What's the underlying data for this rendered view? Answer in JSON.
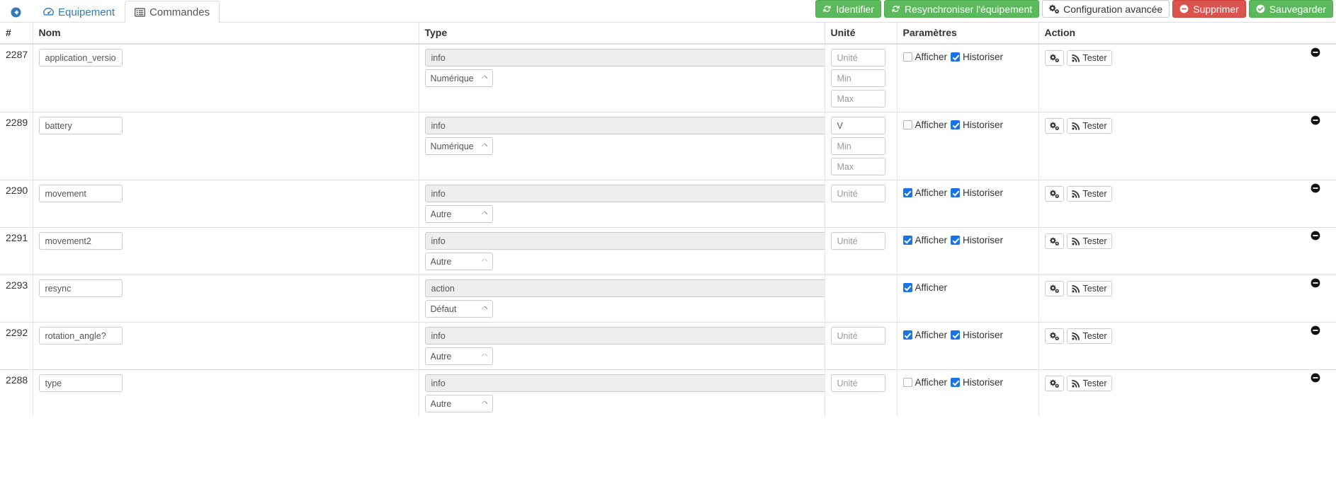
{
  "header": {
    "tabs": [
      {
        "label": "",
        "icon": "back-arrow-icon",
        "state": "link"
      },
      {
        "label": "Equipement",
        "icon": "dashboard-icon",
        "state": "link"
      },
      {
        "label": "Commandes",
        "icon": "list-icon",
        "state": "active"
      }
    ],
    "buttons": [
      {
        "label": "Identifier",
        "icon": "refresh-icon",
        "style": "success",
        "name": "identifier-button"
      },
      {
        "label": "Resynchroniser l'équipement",
        "icon": "refresh-icon",
        "style": "success",
        "name": "resynchroniser-button"
      },
      {
        "label": "Configuration avancée",
        "icon": "gears-icon",
        "style": "default",
        "name": "configuration-avancee-button"
      },
      {
        "label": "Supprimer",
        "icon": "minus-circle-icon",
        "style": "danger",
        "name": "supprimer-button"
      },
      {
        "label": "Sauvegarder",
        "icon": "check-circle-icon",
        "style": "success",
        "name": "sauvegarder-button"
      }
    ]
  },
  "table": {
    "columns": [
      "#",
      "Nom",
      "Type",
      "Unité",
      "Paramètres",
      "Action"
    ],
    "placeholders": {
      "unite": "Unité",
      "min": "Min",
      "max": "Max"
    },
    "labels": {
      "afficher": "Afficher",
      "historiser": "Historiser",
      "tester": "Tester"
    },
    "rows": [
      {
        "id": "2287",
        "nom": "application_version",
        "type": "info",
        "subtype": "Numérique",
        "unite": "",
        "show_minmax": true,
        "afficher": false,
        "historiser": true,
        "has_historiser": true
      },
      {
        "id": "2289",
        "nom": "battery",
        "type": "info",
        "subtype": "Numérique",
        "unite": "V",
        "show_minmax": true,
        "afficher": false,
        "historiser": true,
        "has_historiser": true
      },
      {
        "id": "2290",
        "nom": "movement",
        "type": "info",
        "subtype": "Autre",
        "unite": "",
        "show_minmax": false,
        "afficher": true,
        "historiser": true,
        "has_historiser": true
      },
      {
        "id": "2291",
        "nom": "movement2",
        "type": "info",
        "subtype": "Autre",
        "unite": "",
        "show_minmax": false,
        "afficher": true,
        "historiser": true,
        "has_historiser": true
      },
      {
        "id": "2293",
        "nom": "resync",
        "type": "action",
        "subtype": "Défaut",
        "unite": null,
        "show_minmax": false,
        "afficher": true,
        "historiser": false,
        "has_historiser": false
      },
      {
        "id": "2292",
        "nom": "rotation_angle?",
        "type": "info",
        "subtype": "Autre",
        "unite": "",
        "show_minmax": false,
        "afficher": true,
        "historiser": true,
        "has_historiser": true
      },
      {
        "id": "2288",
        "nom": "type",
        "type": "info",
        "subtype": "Autre",
        "unite": "",
        "show_minmax": false,
        "afficher": false,
        "historiser": true,
        "has_historiser": true
      }
    ]
  },
  "colors": {
    "success": "#5cb85c",
    "danger": "#d9534f",
    "link": "#337ab7",
    "checkbox": "#1a73e8"
  }
}
